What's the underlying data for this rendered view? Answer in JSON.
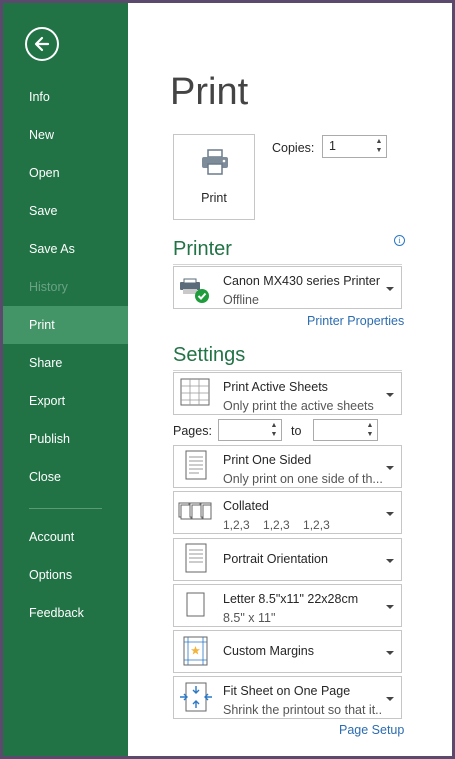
{
  "sidebar": {
    "items": [
      {
        "label": "Info"
      },
      {
        "label": "New"
      },
      {
        "label": "Open"
      },
      {
        "label": "Save"
      },
      {
        "label": "Save As"
      },
      {
        "label": "History"
      },
      {
        "label": "Print"
      },
      {
        "label": "Share"
      },
      {
        "label": "Export"
      },
      {
        "label": "Publish"
      },
      {
        "label": "Close"
      },
      {
        "label": "Account"
      },
      {
        "label": "Options"
      },
      {
        "label": "Feedback"
      }
    ]
  },
  "main": {
    "title": "Print",
    "print_button_label": "Print",
    "copies_label": "Copies:",
    "copies_value": "1",
    "printer": {
      "heading": "Printer",
      "name": "Canon MX430 series Printer",
      "status": "Offline",
      "properties_link": "Printer Properties"
    },
    "settings": {
      "heading": "Settings",
      "what": {
        "title": "Print Active Sheets",
        "desc": "Only print the active sheets"
      },
      "pages_label": "Pages:",
      "to_label": "to",
      "sided": {
        "title": "Print One Sided",
        "desc": "Only print on one side of th..."
      },
      "collated": {
        "title": "Collated",
        "desc": "1,2,3   1,2,3   1,2,3"
      },
      "orientation": {
        "title": "Portrait Orientation"
      },
      "paper": {
        "title": "Letter 8.5\"x11\" 22x28cm",
        "desc": "8.5\" x 11\""
      },
      "margins": {
        "title": "Custom Margins"
      },
      "scaling": {
        "title": "Fit Sheet on One Page",
        "desc": "Shrink the printout so that it..."
      },
      "page_setup_link": "Page Setup"
    }
  },
  "colors": {
    "sidebar": "#217346",
    "sidebar_active": "#439467",
    "accent": "#217346",
    "link": "#2b6cb0"
  }
}
